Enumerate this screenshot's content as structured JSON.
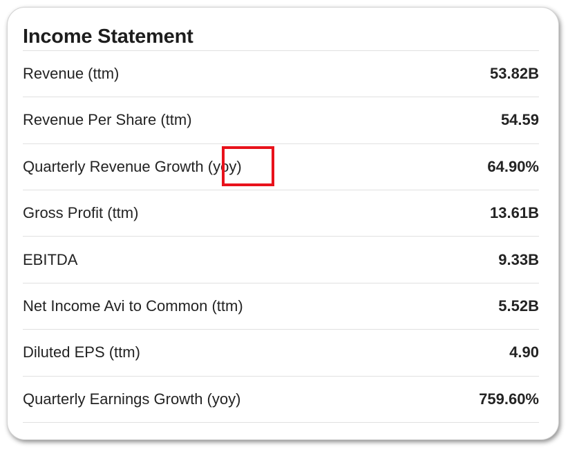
{
  "section": {
    "title": "Income Statement"
  },
  "rows": [
    {
      "label": "Revenue (ttm)",
      "value": "53.82B"
    },
    {
      "label": "Revenue Per Share (ttm)",
      "value": "54.59"
    },
    {
      "label": "Quarterly Revenue Growth (yoy)",
      "value": "64.90%"
    },
    {
      "label": "Gross Profit (ttm)",
      "value": "13.61B"
    },
    {
      "label": "EBITDA",
      "value": "9.33B"
    },
    {
      "label": "Net Income Avi to Common (ttm)",
      "value": "5.52B"
    },
    {
      "label": "Diluted EPS (ttm)",
      "value": "4.90"
    },
    {
      "label": "Quarterly Earnings Growth (yoy)",
      "value": "759.60%"
    }
  ],
  "colors": {
    "highlight_box": "#e8121b",
    "divider": "#e0e0e0",
    "text": "#232323"
  }
}
